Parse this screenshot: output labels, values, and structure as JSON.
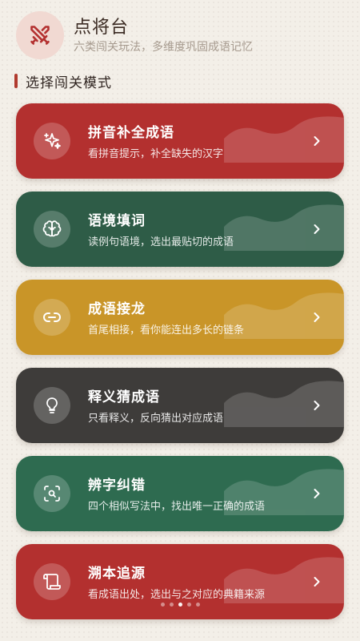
{
  "header": {
    "title": "点将台",
    "subtitle": "六类闯关玩法，多维度巩固成语记忆",
    "logo_icon": "crossed-swords-icon"
  },
  "section": {
    "title": "选择闯关模式"
  },
  "modes": [
    {
      "title": "拼音补全成语",
      "desc": "看拼音提示，补全缺失的汉字",
      "icon": "sparkle-icon",
      "color": "#b3302f"
    },
    {
      "title": "语境填词",
      "desc": "读例句语境，选出最贴切的成语",
      "icon": "brain-icon",
      "color": "#2e5c47"
    },
    {
      "title": "成语接龙",
      "desc": "首尾相接，看你能连出多长的链条",
      "icon": "link-icon",
      "color": "#c99528"
    },
    {
      "title": "释义猜成语",
      "desc": "只看释义，反向猜出对应成语",
      "icon": "lightbulb-icon",
      "color": "#3e3c3a"
    },
    {
      "title": "辨字纠错",
      "desc": "四个相似写法中，找出唯一正确的成语",
      "icon": "scan-search-icon",
      "color": "#2e6b50"
    },
    {
      "title": "溯本追源",
      "desc": "看成语出处，选出与之对应的典籍来源",
      "icon": "scroll-icon",
      "color": "#b3302f"
    }
  ],
  "pagination": {
    "count": 5,
    "active_index": 2
  },
  "colors": {
    "accent": "#b03a2e",
    "background": "#f3efe8"
  }
}
